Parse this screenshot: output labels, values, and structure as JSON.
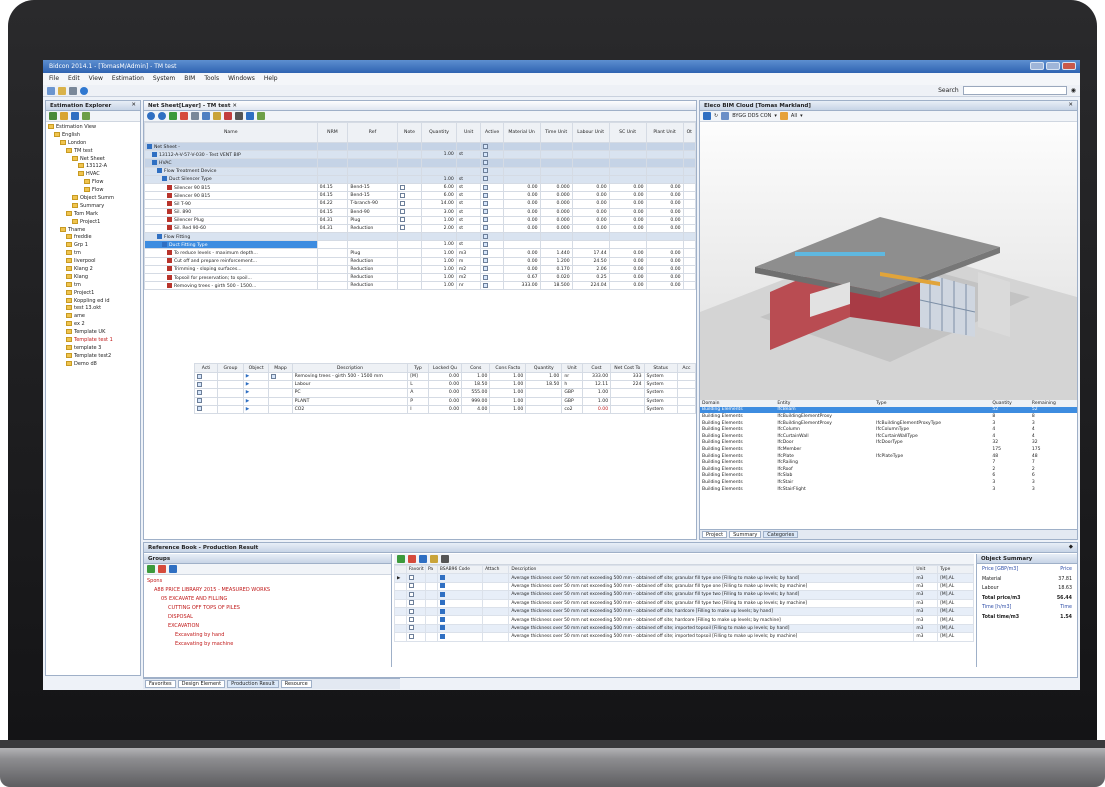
{
  "window": {
    "title": "Bidcon 2014.1 - [TomasM/Admin] - TM test"
  },
  "menu": [
    "File",
    "Edit",
    "View",
    "Estimation",
    "System",
    "BIM",
    "Tools",
    "Windows",
    "Help"
  ],
  "search": {
    "label": "Search"
  },
  "explorer": {
    "title": "Estimation Explorer",
    "items": [
      {
        "label": "Estimation View",
        "d": 0
      },
      {
        "label": "English",
        "d": 1
      },
      {
        "label": "London",
        "d": 2
      },
      {
        "label": "TM test",
        "d": 3
      },
      {
        "label": "Net Sheet",
        "d": 4
      },
      {
        "label": "13112-A",
        "d": 5
      },
      {
        "label": "HVAC",
        "d": 5
      },
      {
        "label": "Flow",
        "d": 6
      },
      {
        "label": "Flow",
        "d": 6
      },
      {
        "label": "Object Summ",
        "d": 4
      },
      {
        "label": "Summary",
        "d": 4
      },
      {
        "label": "Tom Mark",
        "d": 3
      },
      {
        "label": "Project1",
        "d": 4
      },
      {
        "label": "Thame",
        "d": 2
      },
      {
        "label": "freddie",
        "d": 3
      },
      {
        "label": "Grp 1",
        "d": 3
      },
      {
        "label": "tm",
        "d": 3
      },
      {
        "label": "liverpool",
        "d": 3
      },
      {
        "label": "Klang 2",
        "d": 3
      },
      {
        "label": "Klang",
        "d": 3
      },
      {
        "label": "tm",
        "d": 3
      },
      {
        "label": "Project1",
        "d": 3
      },
      {
        "label": "Koppling ed id",
        "d": 3
      },
      {
        "label": "test 13.okt",
        "d": 3
      },
      {
        "label": "ame",
        "d": 3
      },
      {
        "label": "ex 2",
        "d": 3
      },
      {
        "label": "Template UK",
        "d": 3
      },
      {
        "label": "Template test 1",
        "d": 3,
        "red": true
      },
      {
        "label": "template 3",
        "d": 3
      },
      {
        "label": "Template test2",
        "d": 3
      },
      {
        "label": "Demo d8",
        "d": 3
      }
    ]
  },
  "netsheet": {
    "tab": "Net Sheet[Layer] - TM test",
    "columns": [
      "Name",
      "NRM",
      "Ref",
      "Note",
      "Quantity",
      "Unit",
      "Active",
      "Material Un",
      "Time Unit",
      "Labour Unit",
      "SC Unit",
      "Plant Unit",
      "Ot"
    ],
    "rows": [
      {
        "name": "Net Sheet -",
        "t": "g",
        "d": 0
      },
      {
        "name": "13112-A-V-57-V-030 - Test VENT BIP",
        "q": "1.00",
        "u": "st",
        "t": "g2",
        "d": 1
      },
      {
        "name": "HVAC",
        "t": "g",
        "d": 1
      },
      {
        "name": "Flow Treatment Device",
        "t": "g2",
        "d": 2
      },
      {
        "name": "Duct Silencer Type",
        "q": "1.00",
        "u": "st",
        "t": "g2",
        "d": 3
      },
      {
        "name": "Silencer 90 B15",
        "nrm": "04.15",
        "ref": "Bend-15",
        "q": "6.00",
        "u": "st",
        "m": "0.00",
        "ti": "0.000",
        "l": "0.00",
        "sc": "0.00",
        "p": "0.00",
        "d": 4
      },
      {
        "name": "Silencer 90 B15",
        "nrm": "04.15",
        "ref": "Bend-15",
        "q": "6.00",
        "u": "st",
        "m": "0.00",
        "ti": "0.000",
        "l": "0.00",
        "sc": "0.00",
        "p": "0.00",
        "d": 4
      },
      {
        "name": "Sil T-90",
        "nrm": "04.22",
        "ref": "T-branch-90",
        "q": "14.00",
        "u": "st",
        "m": "0.00",
        "ti": "0.000",
        "l": "0.00",
        "sc": "0.00",
        "p": "0.00",
        "d": 4
      },
      {
        "name": "Sil. 890",
        "nrm": "04.15",
        "ref": "Bend-90",
        "q": "3.00",
        "u": "st",
        "m": "0.00",
        "ti": "0.000",
        "l": "0.00",
        "sc": "0.00",
        "p": "0.00",
        "d": 4
      },
      {
        "name": "Silencer Plug",
        "nrm": "04.31",
        "ref": "Plug",
        "q": "1.00",
        "u": "st",
        "m": "0.00",
        "ti": "0.000",
        "l": "0.00",
        "sc": "0.00",
        "p": "0.00",
        "d": 4
      },
      {
        "name": "Sil. Red 90-60",
        "nrm": "04.31",
        "ref": "Reduction",
        "q": "2.00",
        "u": "st",
        "m": "0.00",
        "ti": "0.000",
        "l": "0.00",
        "sc": "0.00",
        "p": "0.00",
        "d": 4
      },
      {
        "name": "Flow Fitting",
        "t": "g2",
        "d": 2
      },
      {
        "name": "Duct Fitting Type",
        "q": "1.00",
        "u": "st",
        "t": "sel",
        "d": 3
      },
      {
        "name": "To reduce levels - maximum depth...",
        "ref": "Plug",
        "q": "1.00",
        "u": "m3",
        "m": "0.00",
        "ti": "1.440",
        "l": "17.44",
        "sc": "0.00",
        "p": "0.00",
        "d": 4
      },
      {
        "name": "Cut off and prepare reinforcement...",
        "ref": "Reduction",
        "q": "1.00",
        "u": "m",
        "m": "0.00",
        "ti": "1.200",
        "l": "24.50",
        "sc": "0.00",
        "p": "0.00",
        "d": 4
      },
      {
        "name": "Trimming - sloping surfaces...",
        "ref": "Reduction",
        "q": "1.00",
        "u": "m2",
        "m": "0.00",
        "ti": "0.170",
        "l": "2.06",
        "sc": "0.00",
        "p": "0.00",
        "d": 4
      },
      {
        "name": "Topsoil for preservation; to spoil...",
        "ref": "Reduction",
        "q": "1.00",
        "u": "m2",
        "m": "0.67",
        "ti": "0.020",
        "l": "0.25",
        "sc": "0.00",
        "p": "0.00",
        "d": 4
      },
      {
        "name": "Removing trees - girth 500 - 1500...",
        "ref": "Reduction",
        "q": "1.00",
        "u": "nr",
        "m": "333.00",
        "ti": "18.500",
        "l": "224.04",
        "sc": "0.00",
        "p": "0.00",
        "d": 4
      }
    ],
    "sub_columns": [
      "Acti",
      "Group",
      "Object",
      "Mapp",
      "Description",
      "Typ",
      "Locked Qu",
      "Cons",
      "Cons Facto",
      "Quantity",
      "Unit",
      "Cost",
      "Net Cost To",
      "Status",
      "Acc"
    ],
    "sub_rows": [
      {
        "desc": "Removing trees - girth 500 - 1500 mm",
        "typ": "[M]",
        "lq": "0.00",
        "cons": "1.00",
        "cf": "1.00",
        "qty": "1.00",
        "unit": "nr",
        "cost": "333.00",
        "net": "333",
        "st": "System"
      },
      {
        "desc": "Labour",
        "typ": "L",
        "lq": "0.00",
        "cons": "18.50",
        "cf": "1.00",
        "qty": "18.50",
        "unit": "h",
        "cost": "12.11",
        "net": "224",
        "st": "System"
      },
      {
        "desc": "PC",
        "typ": "A",
        "lq": "0.00",
        "cons": "555.00",
        "cf": "1.00",
        "qty": "",
        "unit": "GBP",
        "cost": "1.00",
        "net": "",
        "st": "System"
      },
      {
        "desc": "PLANT",
        "typ": "P",
        "lq": "0.00",
        "cons": "999.00",
        "cf": "1.00",
        "qty": "",
        "unit": "GBP",
        "cost": "1.00",
        "net": "",
        "st": "System"
      },
      {
        "desc": "CO2",
        "typ": "I",
        "lq": "0.00",
        "cons": "4.00",
        "cf": "1.00",
        "qty": "",
        "unit": "co2",
        "cost": "0.00",
        "net": "",
        "st": "System"
      }
    ]
  },
  "bim": {
    "title": "Eleco BIM Cloud [Tomas Markland]",
    "project": "BYGG DDS CON",
    "filter": "All",
    "columns": [
      "Domain",
      "Entity",
      "Type",
      "Quantity",
      "Remaining"
    ],
    "rows": [
      [
        "Building Elements",
        "IfcBeam",
        "",
        "52",
        "52"
      ],
      [
        "Building Elements",
        "IfcBuildingElementProxy",
        "",
        "8",
        "8"
      ],
      [
        "Building Elements",
        "IfcBuildingElementProxy",
        "IfcBuildingElementProxyType",
        "3",
        "3"
      ],
      [
        "Building Elements",
        "IfcColumn",
        "IfcColumnType",
        "4",
        "4"
      ],
      [
        "Building Elements",
        "IfcCurtainWall",
        "IfcCurtainWallType",
        "4",
        "4"
      ],
      [
        "Building Elements",
        "IfcDoor",
        "IfcDoorType",
        "32",
        "32"
      ],
      [
        "Building Elements",
        "IfcMember",
        "",
        "175",
        "175"
      ],
      [
        "Building Elements",
        "IfcPlate",
        "IfcPlateType",
        "48",
        "48"
      ],
      [
        "Building Elements",
        "IfcRailing",
        "",
        "7",
        "7"
      ],
      [
        "Building Elements",
        "IfcRoof",
        "",
        "2",
        "2"
      ],
      [
        "Building Elements",
        "IfcSlab",
        "",
        "6",
        "6"
      ],
      [
        "Building Elements",
        "IfcStair",
        "",
        "3",
        "3"
      ],
      [
        "Building Elements",
        "IfcStairFlight",
        "",
        "3",
        "3"
      ]
    ],
    "tabs": [
      "Project",
      "Summary",
      "Categories"
    ]
  },
  "refbook": {
    "title": "Reference Book - Production Result"
  },
  "groups": {
    "title": "Groups",
    "items": [
      {
        "label": "Spons",
        "d": 0
      },
      {
        "label": "A88 PRICE LIBRARY 2015 - MEASURED WORKS",
        "d": 1
      },
      {
        "label": "05 EXCAVATE AND FILLING",
        "d": 2
      },
      {
        "label": "CUTTING OFF TOPS OF PILES",
        "d": 3
      },
      {
        "label": "DISPOSAL",
        "d": 3
      },
      {
        "label": "EXCAVATION",
        "d": 3
      },
      {
        "label": "Excavating by hand",
        "d": 4
      },
      {
        "label": "Excavating by machine",
        "d": 4
      }
    ]
  },
  "results": {
    "columns": [
      "Favorit",
      "Pa",
      "BSAB96 Code",
      "Attach",
      "Description",
      "Unit",
      "Type"
    ],
    "rows": [
      [
        "Average thickness over 50 mm not exceeding 500 mm - obtained off site; granular fill type one [Filling to make up levels; by hand]",
        "m3",
        "[M],AL"
      ],
      [
        "Average thickness over 50 mm not exceeding 500 mm - obtained off site; granular fill type one [Filling to make up levels; by machine]",
        "m3",
        "[M],AL"
      ],
      [
        "Average thickness over 50 mm not exceeding 500 mm - obtained off site; granular fill type two [Filling to make up levels; by hand]",
        "m3",
        "[M],AL"
      ],
      [
        "Average thickness over 50 mm not exceeding 500 mm - obtained off site; granular fill type two [Filling to make up levels; by machine]",
        "m3",
        "[M],AL"
      ],
      [
        "Average thickness over 50 mm not exceeding 500 mm - obtained off site; hardcore [Filling to make up levels; by hand]",
        "m3",
        "[M],AL"
      ],
      [
        "Average thickness over 50 mm not exceeding 500 mm - obtained off site; hardcore [Filling to make up levels; by machine]",
        "m3",
        "[M],AL"
      ],
      [
        "Average thickness over 50 mm not exceeding 500 mm - obtained off site; imported topsoil [Filling to make up levels; by hand]",
        "m3",
        "[M],AL"
      ],
      [
        "Average thickness over 50 mm not exceeding 500 mm - obtained off site; imported topsoil [Filling to make up levels; by machine]",
        "m3",
        "[M],AL"
      ]
    ]
  },
  "summary": {
    "title": "Object Summary",
    "rows": [
      [
        "Price [GBP/m3]",
        "Price"
      ],
      [
        "Material",
        "37.81"
      ],
      [
        "Labour",
        "18.63"
      ],
      [
        "Total price/m3",
        "56.44"
      ],
      [
        "Time [h/m3]",
        "Time"
      ],
      [
        "Total time/m3",
        "1.54"
      ]
    ]
  },
  "bottom_tabs": [
    "Favorites",
    "Design Element",
    "Production Result",
    "Resource"
  ]
}
